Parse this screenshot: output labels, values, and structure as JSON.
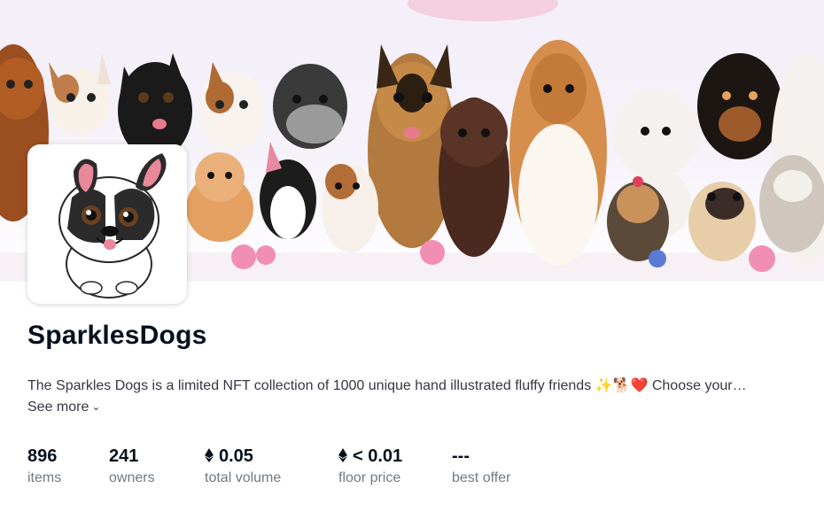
{
  "collection": {
    "name": "SparklesDogs",
    "description": "The Sparkles Dogs is a limited NFT collection of 1000 unique hand illustrated fluffy friends ✨🐕❤️ Choose your…",
    "see_more_label": "See more",
    "banner_icon": "dog-illustrations-banner",
    "avatar_icon": "french-bulldog-avatar"
  },
  "stats": [
    {
      "value": "896",
      "label": "items",
      "currency_icon": ""
    },
    {
      "value": "241",
      "label": "owners",
      "currency_icon": ""
    },
    {
      "value": "0.05",
      "label": "total volume",
      "currency_icon": "eth-icon"
    },
    {
      "value": "< 0.01",
      "label": "floor price",
      "currency_icon": "eth-icon"
    },
    {
      "value": "---",
      "label": "best offer",
      "currency_icon": ""
    }
  ],
  "colors": {
    "text_primary": "#04111d",
    "text_secondary": "#707a83",
    "text_body": "#353840"
  }
}
